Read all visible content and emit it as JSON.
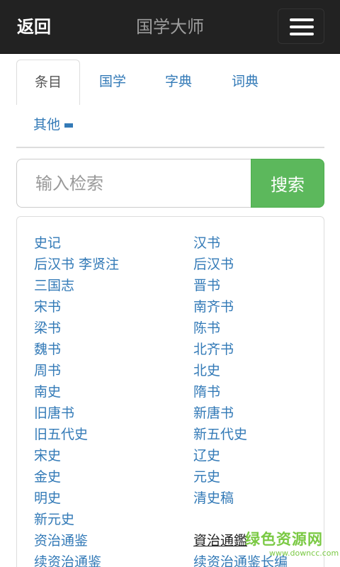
{
  "header": {
    "back_label": "返回",
    "title": "国学大师",
    "menu_icon": "hamburger-icon"
  },
  "tabs": {
    "items": [
      "条目",
      "国学",
      "字典",
      "词典"
    ],
    "active": "条目",
    "more_label": "其他"
  },
  "search": {
    "placeholder": "输入检索",
    "value": "",
    "button_label": "搜索"
  },
  "books": [
    "史记",
    "汉书",
    "后汉书 李贤注",
    "后汉书",
    "三国志",
    "晋书",
    "宋书",
    "南齐书",
    "梁书",
    "陈书",
    "魏书",
    "北齐书",
    "周书",
    "北史",
    "南史",
    "隋书",
    "旧唐书",
    "新唐书",
    "旧五代史",
    "新五代史",
    "宋史",
    "辽史",
    "金史",
    "元史",
    "明史",
    "清史稿",
    "新元史",
    "",
    "资治通鉴",
    "資治通鑑",
    "续资治通鉴",
    "续资治通鉴长编"
  ],
  "watermark": {
    "main": "绿色资源网",
    "sub": "www.downcc.com"
  }
}
